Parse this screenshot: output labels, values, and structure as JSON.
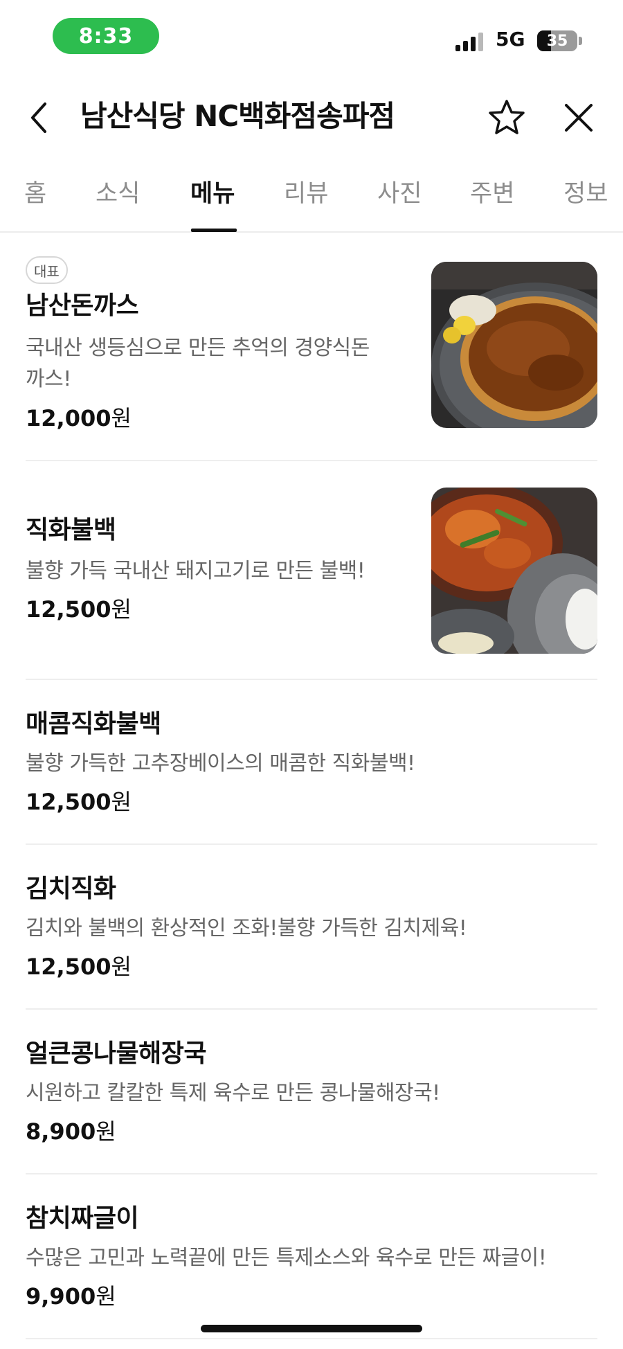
{
  "status_bar": {
    "time": "8:33",
    "network": "5G",
    "battery": "35",
    "battery_level": 0.35,
    "time_pill_color": "#2dbd4f"
  },
  "header": {
    "title": "남산식당 NC백화점송파점",
    "back_icon": "chevron-left-icon",
    "favorite_icon": "star-outline-icon",
    "close_icon": "close-icon"
  },
  "tabs": [
    {
      "label": "홈",
      "active": false
    },
    {
      "label": "소식",
      "active": false
    },
    {
      "label": "메뉴",
      "active": true
    },
    {
      "label": "리뷰",
      "active": false
    },
    {
      "label": "사진",
      "active": false
    },
    {
      "label": "주변",
      "active": false
    },
    {
      "label": "정보",
      "active": false
    }
  ],
  "menu": [
    {
      "badge": "대표",
      "name": "남산돈까스",
      "description": "국내산 생등심으로 만든 추억의 경양식돈까스!",
      "description_lines": [
        "국내산 생등심으로 만든 추억의 경양식돈",
        "까스!"
      ],
      "price": "12,000",
      "currency": "원",
      "has_photo": true
    },
    {
      "name": "직화불백",
      "description": "불향 가득 국내산 돼지고기로 만든 불백!",
      "price": "12,500",
      "currency": "원",
      "has_photo": true
    },
    {
      "name": "매콤직화불백",
      "description": "불향 가득한 고추장베이스의 매콤한 직화불백!",
      "price": "12,500",
      "currency": "원",
      "has_photo": false
    },
    {
      "name": "김치직화",
      "description": "김치와 불백의 환상적인 조화!불향 가득한 김치제육!",
      "price": "12,500",
      "currency": "원",
      "has_photo": false
    },
    {
      "name": "얼큰콩나물해장국",
      "description": "시원하고 칼칼한 특제 육수로 만든 콩나물해장국!",
      "price": "8,900",
      "currency": "원",
      "has_photo": false
    },
    {
      "name": "참치짜글이",
      "description": "수많은 고민과 노력끝에 만든 특제소스와 육수로 만든 짜글이!",
      "price": "9,900",
      "currency": "원",
      "has_photo": false
    }
  ]
}
